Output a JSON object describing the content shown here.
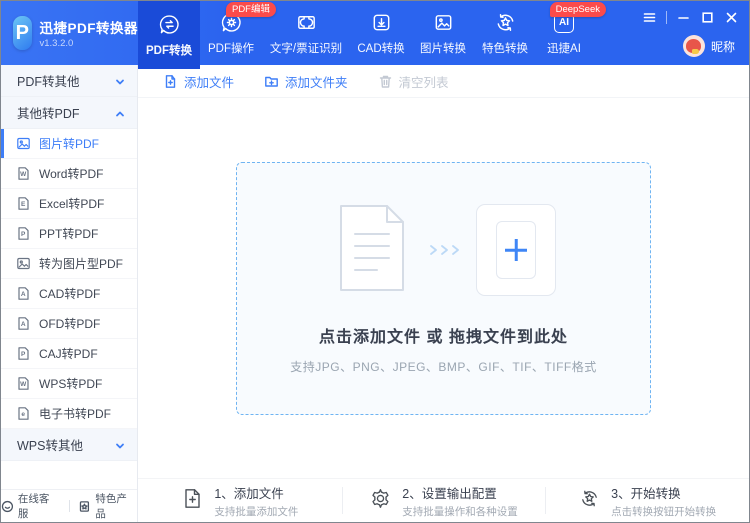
{
  "app": {
    "name": "迅捷PDF转换器",
    "version": "v1.3.2.0",
    "logo_letter": "P"
  },
  "header": {
    "nav": [
      {
        "label": "PDF转换",
        "active": true
      },
      {
        "label": "PDF操作",
        "badge": "PDF编辑"
      },
      {
        "label": "文字/票证识别"
      },
      {
        "label": "CAD转换"
      },
      {
        "label": "图片转换"
      },
      {
        "label": "特色转换"
      },
      {
        "label": "迅捷AI",
        "badge": "DeepSeek",
        "icon_label": "AI"
      }
    ],
    "user_name": "昵称"
  },
  "toolbar": {
    "add_file": "添加文件",
    "add_folder": "添加文件夹",
    "clear_list": "清空列表"
  },
  "sidebar": {
    "groups": [
      {
        "label": "PDF转其他",
        "expanded": false
      },
      {
        "label": "其他转PDF",
        "expanded": true
      },
      {
        "label": "WPS转其他",
        "expanded": false
      }
    ],
    "items": [
      {
        "label": "图片转PDF",
        "active": true
      },
      {
        "label": "Word转PDF",
        "glyph": "W"
      },
      {
        "label": "Excel转PDF",
        "glyph": "E"
      },
      {
        "label": "PPT转PDF",
        "glyph": "P"
      },
      {
        "label": "转为图片型PDF"
      },
      {
        "label": "CAD转PDF",
        "glyph": "A"
      },
      {
        "label": "OFD转PDF",
        "glyph": "A"
      },
      {
        "label": "CAJ转PDF",
        "glyph": "P"
      },
      {
        "label": "WPS转PDF",
        "glyph": "W"
      },
      {
        "label": "电子书转PDF",
        "glyph": "e"
      }
    ],
    "footer": [
      {
        "label": "在线客服"
      },
      {
        "label": "特色产品"
      }
    ]
  },
  "dropzone": {
    "main_text": "点击添加文件 或 拖拽文件到此处",
    "sub_text": "支持JPG、PNG、JPEG、BMP、GIF、TIF、TIFF格式"
  },
  "steps": [
    {
      "title": "1、添加文件",
      "subtitle": "支持批量添加文件"
    },
    {
      "title": "2、设置输出配置",
      "subtitle": "支持批量操作和各种设置"
    },
    {
      "title": "3、开始转换",
      "subtitle": "点击转换按钮开始转换"
    }
  ],
  "colors": {
    "header_blue": "#2B64EF",
    "active_tab_blue": "#1A4BD8",
    "accent_blue": "#3E7EF7",
    "badge_red": "#FB4B4B",
    "dropzone_border": "#6FB4F2",
    "dropzone_bg": "#F8FBFE"
  }
}
